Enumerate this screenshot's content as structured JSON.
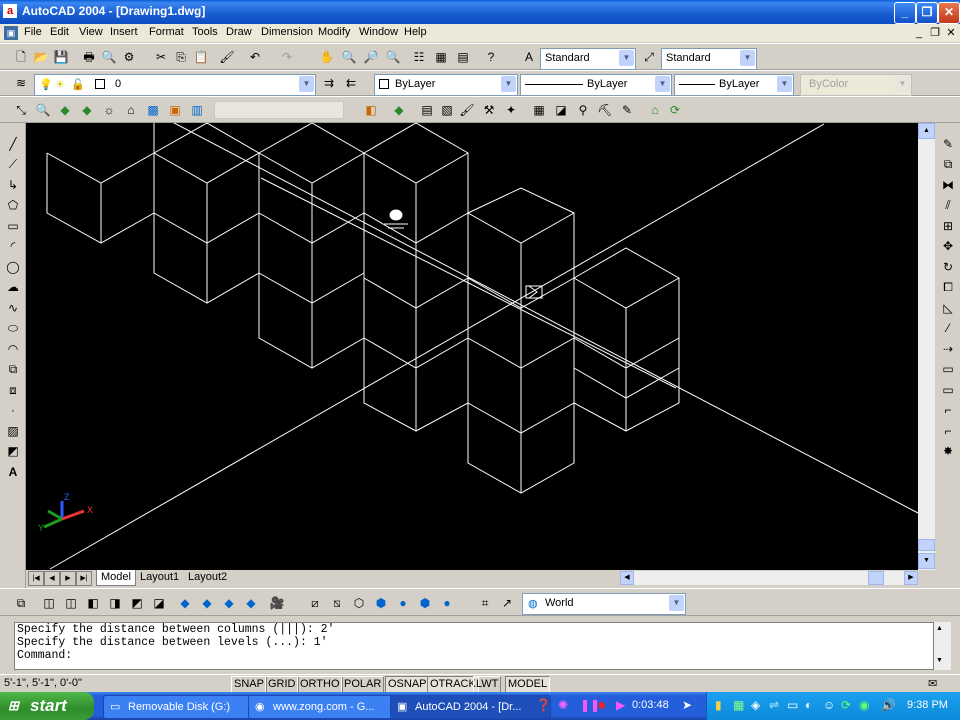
{
  "window": {
    "title": "AutoCAD 2004 - [Drawing1.dwg]",
    "min": "_",
    "max": "❐",
    "close": "✕"
  },
  "menu": {
    "items": [
      "File",
      "Edit",
      "View",
      "Insert",
      "Format",
      "Tools",
      "Draw",
      "Dimension",
      "Modify",
      "Window",
      "Help"
    ]
  },
  "styles": {
    "text_style": "Standard",
    "dim_style": "Standard"
  },
  "layers": {
    "current_layer": "0"
  },
  "properties": {
    "color": "ByLayer",
    "linetype": "ByLayer",
    "lineweight": "ByLayer",
    "plotstyle": "ByColor"
  },
  "ucs": {
    "name": "World"
  },
  "layout_tabs": [
    "Model",
    "Layout1",
    "Layout2"
  ],
  "command": {
    "lines": [
      "Specify the distance between columns (|||): 2'",
      "Specify the distance between levels (...): 1'",
      "Command:"
    ]
  },
  "status": {
    "coords": "5'-1\",  5'-1\", 0'-0\"",
    "toggles": [
      {
        "label": "SNAP",
        "on": false
      },
      {
        "label": "GRID",
        "on": false
      },
      {
        "label": "ORTHO",
        "on": false
      },
      {
        "label": "POLAR",
        "on": false
      },
      {
        "label": "OSNAP",
        "on": true
      },
      {
        "label": "OTRACK",
        "on": true
      },
      {
        "label": "LWT",
        "on": false
      },
      {
        "label": "MODEL",
        "on": true
      }
    ]
  },
  "taskbar": {
    "start": "start",
    "tasks": [
      {
        "label": "Removable Disk (G:)",
        "active": false
      },
      {
        "label": "www.zong.com - G...",
        "active": false
      },
      {
        "label": "AutoCAD 2004 - [Dr...",
        "active": true
      }
    ],
    "timer": "0:03:48",
    "clock": "9:38 PM"
  },
  "ucs_icon": {
    "x": "X",
    "y": "Y",
    "z": "Z"
  }
}
